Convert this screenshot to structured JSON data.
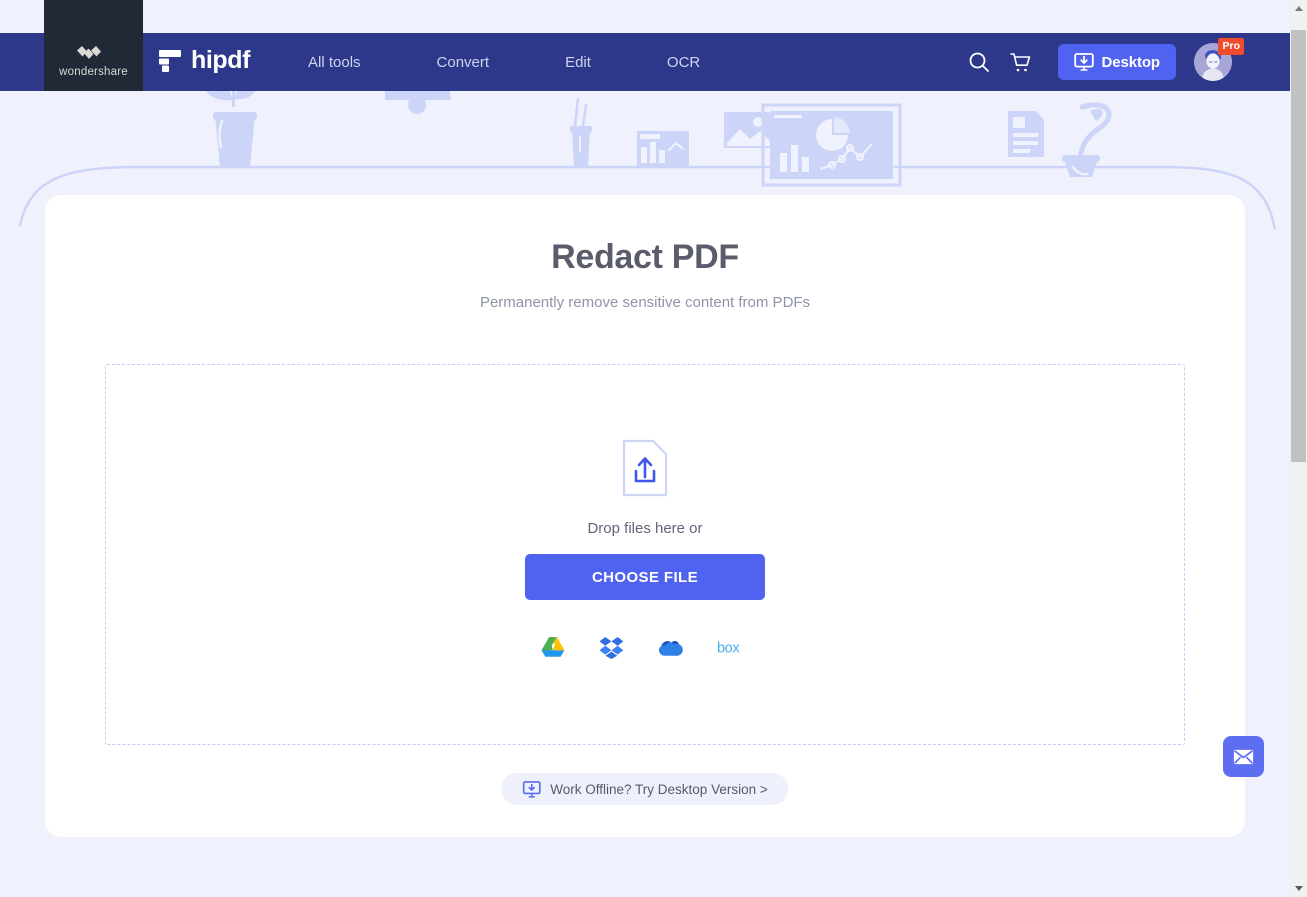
{
  "colors": {
    "nav_bg": "#2d388a",
    "brand_block": "#212936",
    "accent": "#4f62f0",
    "page_bg": "#eff1fd",
    "card_bg": "#ffffff",
    "title_text": "#5a5c6b",
    "subtitle_text": "#8e93a8",
    "dropzone_border": "#c3cdf3",
    "pro_badge": "#ef4b2c",
    "fab": "#5d6ef3"
  },
  "brand": {
    "company": "wondershare",
    "company_mark": "wondershare-w-icon",
    "product": "hipdf",
    "product_mark": "hipdf-logo-icon"
  },
  "nav": {
    "links": [
      {
        "label": "All tools",
        "name": "nav-link-all-tools"
      },
      {
        "label": "Convert",
        "name": "nav-link-convert"
      },
      {
        "label": "Edit",
        "name": "nav-link-edit"
      },
      {
        "label": "OCR",
        "name": "nav-link-ocr"
      }
    ],
    "search_icon": "search-icon",
    "cart_icon": "shopping-cart-icon",
    "desktop_button": {
      "label": "Desktop",
      "icon": "download-to-monitor-icon"
    },
    "account": {
      "avatar": "user-avatar",
      "badge": "Pro"
    }
  },
  "main": {
    "title": "Redact PDF",
    "subtitle": "Permanently remove sensitive content from PDFs",
    "dropzone": {
      "upload_icon": "document-upload-icon",
      "drop_text": "Drop files here or",
      "choose_file_label": "CHOOSE FILE",
      "cloud_sources": [
        {
          "label": "Google Drive",
          "name": "google-drive-icon"
        },
        {
          "label": "Dropbox",
          "name": "dropbox-icon"
        },
        {
          "label": "OneDrive",
          "name": "onedrive-icon"
        },
        {
          "label": "Box",
          "name": "box-icon"
        }
      ]
    },
    "offline_pill": {
      "icon": "download-to-monitor-icon",
      "label": "Work Offline? Try Desktop Version >"
    }
  },
  "floating": {
    "mail_button": {
      "icon": "envelope-icon",
      "label": "Contact support"
    }
  },
  "scrollbar": {
    "up_arrow": "scroll-up-arrow",
    "down_arrow": "scroll-down-arrow",
    "thumb": "scrollbar-thumb"
  }
}
